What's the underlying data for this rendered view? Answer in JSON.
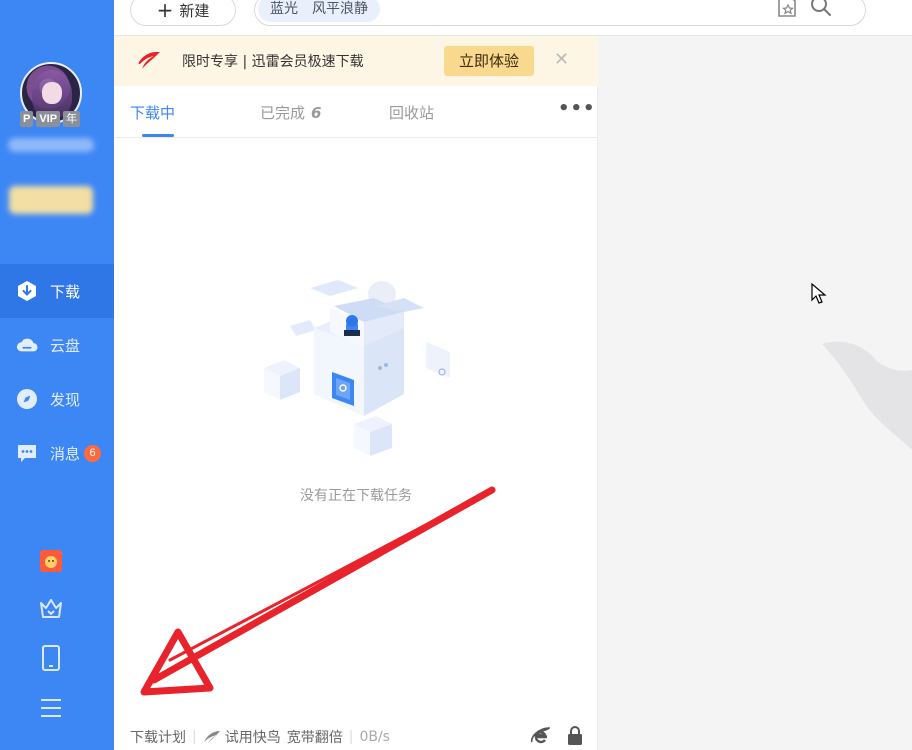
{
  "sidebar": {
    "badges": {
      "p": "P",
      "vip": "VIP",
      "year": "年"
    },
    "nav": [
      {
        "label": "下载",
        "icon": "download-icon",
        "active": true
      },
      {
        "label": "云盘",
        "icon": "cloud-icon"
      },
      {
        "label": "发现",
        "icon": "compass-icon"
      },
      {
        "label": "消息",
        "icon": "message-icon",
        "count": "6"
      }
    ],
    "bottom_icons": [
      "gift-icon",
      "crown-icon",
      "phone-icon",
      "menu-icon"
    ]
  },
  "topbar": {
    "new_button": "新建",
    "search_tags": [
      "蓝光",
      "风平浪静"
    ]
  },
  "promo": {
    "text": "限时专享 | 迅雷会员极速下载",
    "button": "立即体验"
  },
  "tabs": {
    "downloading": "下载中",
    "completed": "已完成",
    "completed_count": "6",
    "recycle": "回收站"
  },
  "empty_message": "没有正在下载任务",
  "statusbar": {
    "plan": "下载计划",
    "try_bird": "试用快鸟",
    "bandwidth": "宽带翻倍",
    "speed": "0B/s"
  },
  "colors": {
    "sidebar": "#3d87f5",
    "accent": "#3d87f5",
    "promo_bg": "#fdf6e5",
    "promo_button": "#f9d98e",
    "annotation_arrow": "#e8232b"
  }
}
